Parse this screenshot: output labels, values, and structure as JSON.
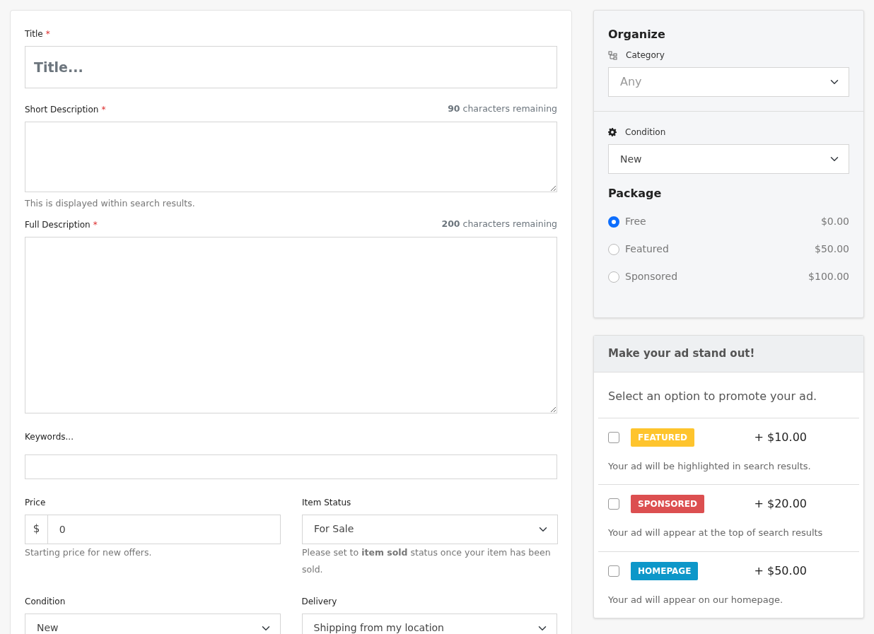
{
  "form": {
    "title": {
      "label": "Title",
      "required_mark": "*",
      "placeholder": "Title..."
    },
    "short_description": {
      "label": "Short Description",
      "required_mark": "*",
      "counter": "**90** characters remaining",
      "help": "This is displayed within search results."
    },
    "full_description": {
      "label": "Full Description",
      "required_mark": "*",
      "counter": "**200** characters remaining"
    },
    "keywords": {
      "label": "Keywords..."
    },
    "price": {
      "label": "Price",
      "prefix": "$",
      "value": "0",
      "help": "Starting price for new offers."
    },
    "item_status": {
      "label": "Item Status",
      "value": "For Sale",
      "help": "Please set to **item sold** status once your item has been sold."
    },
    "condition": {
      "label": "Condition",
      "value": "New"
    },
    "delivery": {
      "label": "Delivery",
      "value": "Shipping from my location"
    }
  },
  "organize": {
    "title": "Organize",
    "category_label": "Category",
    "category_value": "Any",
    "condition_label": "Condition",
    "condition_value": "New",
    "package_title": "Package",
    "packages": [
      {
        "label": "Free",
        "price": "$0.00",
        "selected": true
      },
      {
        "label": "Featured",
        "price": "$50.00",
        "selected": false
      },
      {
        "label": "Sponsored",
        "price": "$100.00",
        "selected": false
      }
    ]
  },
  "promote": {
    "title": "Make your ad stand out!",
    "intro": "Select an option to promote your ad.",
    "options": [
      {
        "badge": "FEATURED",
        "color": "#fec42d",
        "price": "+ $10.00",
        "description": "Your ad will be highlighted in search results.",
        "checked": false
      },
      {
        "badge": "SPONSORED",
        "color": "#dc4f50",
        "price": "+ $20.00",
        "description": "Your ad will appear at the top of search results",
        "checked": false
      },
      {
        "badge": "HOMEPAGE",
        "color": "#0d97c9",
        "price": "+ $50.00",
        "description": "Your ad will appear on our homepage.",
        "checked": false
      }
    ]
  }
}
